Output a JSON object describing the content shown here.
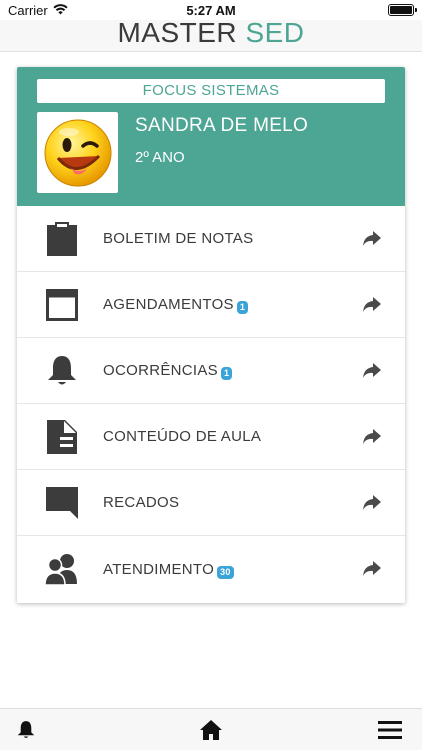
{
  "status_bar": {
    "carrier": "Carrier",
    "time": "5:27 AM"
  },
  "app": {
    "title_part1": "MASTER",
    "title_part2": "SED"
  },
  "student_card": {
    "organization": "FOCUS SISTEMAS",
    "student_name": "SANDRA DE MELO",
    "grade": "2º ANO",
    "avatar_icon": "winking-smiley-face"
  },
  "menu": {
    "items": [
      {
        "label": "BOLETIM DE NOTAS",
        "icon": "clipboard-icon"
      },
      {
        "label": "AGENDAMENTOS",
        "icon": "calendar-window-icon",
        "badge": "1"
      },
      {
        "label": "OCORRÊNCIAS",
        "icon": "bell-icon",
        "badge": "1"
      },
      {
        "label": "CONTEÚDO DE AULA",
        "icon": "document-icon"
      },
      {
        "label": "RECADOS",
        "icon": "chat-bubble-icon"
      },
      {
        "label": "ATENDIMENTO",
        "icon": "users-icon",
        "badge": "30"
      }
    ],
    "arrow_icon": "share-arrow-icon"
  },
  "tab_bar": {
    "items": [
      "bell-icon",
      "home-icon",
      "menu-icon"
    ]
  },
  "colors": {
    "accent": "#4da593",
    "badge": "#3aa3d8",
    "icon": "#3c3c3c"
  }
}
